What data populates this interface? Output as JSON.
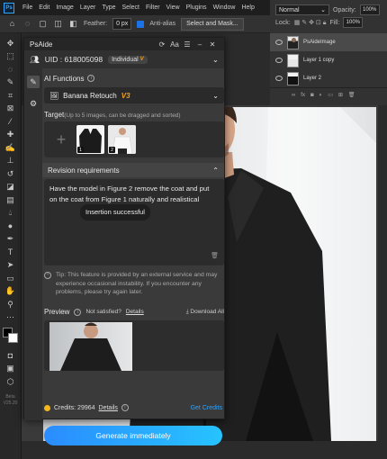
{
  "menu": {
    "items": [
      "File",
      "Edit",
      "Image",
      "Layer",
      "Type",
      "Select",
      "Filter",
      "View",
      "Plugins",
      "Window",
      "Help"
    ]
  },
  "options": {
    "feather_label": "Feather:",
    "feather_value": "0 px",
    "antialias_label": "Anti-alias",
    "select_mask_label": "Select and Mask..."
  },
  "layers_panel": {
    "blend_mode": "Normal",
    "opacity_label": "Opacity:",
    "opacity_value": "100%",
    "lock_label": "Lock:",
    "fill_label": "Fill:",
    "fill_value": "100%",
    "layers": [
      {
        "name": "PsAideImage",
        "active": true
      },
      {
        "name": "Layer 1 copy",
        "active": false
      },
      {
        "name": "Layer 2",
        "active": false
      }
    ]
  },
  "toolbar": {
    "beta_label": "Beta",
    "version_label": "V25.20"
  },
  "plugin": {
    "title": "PsAide",
    "uid_label": "UID : 618005098",
    "account_type": "Individual",
    "vip_label": "V",
    "ai_functions_label": "AI Functions",
    "function_selected": "Banana Retouch",
    "function_version": "V3",
    "target_label": "Target",
    "target_hint": "(Up to 5 images, can be dragged and sorted)",
    "target_images": [
      {
        "number": "1",
        "color": "#1b1b1b"
      },
      {
        "number": "2",
        "color": "#f0f0f0"
      }
    ],
    "revision_label": "Revision requirements",
    "revision_text": "Have the model in Figure 2 remove the coat and put on the coat from Figure 1 naturally and realistical",
    "toast": "Insertion successful",
    "tip": "Tip: This feature is provided by an external service and may experience occasional instability. If you encounter any problems, please try again later.",
    "preview_label": "Preview",
    "not_satisfied_label": "Not satisfied?",
    "details_label": "Details",
    "download_all_label": "Download All",
    "credits_label": "Credits: 29964",
    "credits_details_label": "Details",
    "get_credits_label": "Get Credits",
    "generate_label": "Generate immediately"
  },
  "colors": {
    "accent_blue": "#2da3ff",
    "vip_orange": "#f0a020",
    "coin_gold": "#f3b71d"
  }
}
